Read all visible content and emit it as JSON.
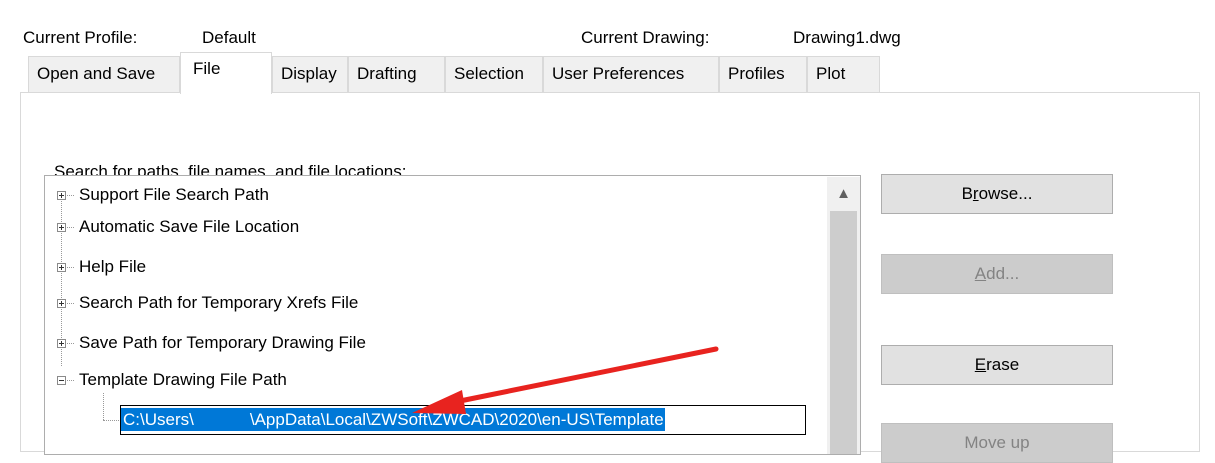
{
  "header": {
    "current_profile_label": "Current Profile:",
    "current_profile_value": "Default",
    "current_drawing_label": "Current Drawing:",
    "current_drawing_value": "Drawing1.dwg"
  },
  "tabs": [
    {
      "label": "Open and Save"
    },
    {
      "label": "File",
      "active": true
    },
    {
      "label": "Display"
    },
    {
      "label": "Drafting"
    },
    {
      "label": "Selection"
    },
    {
      "label": "User Preferences"
    },
    {
      "label": "Profiles"
    },
    {
      "label": "Plot"
    }
  ],
  "panel": {
    "search_label": "Search for paths, file names, and file locations:",
    "tree": [
      {
        "label": "Support File Search Path",
        "expanded": false
      },
      {
        "label": "Automatic Save File Location",
        "expanded": false
      },
      {
        "label": "Help File",
        "expanded": false
      },
      {
        "label": "Search Path for Temporary Xrefs File",
        "expanded": false
      },
      {
        "label": "Save Path for Temporary Drawing File",
        "expanded": false
      },
      {
        "label": "Template Drawing File Path",
        "expanded": true
      }
    ],
    "template_path": {
      "part1": "C:\\Users\\",
      "part2": "\\AppData\\Local\\ZWSoft\\ZWCAD\\2020\\en-US\\Template"
    }
  },
  "buttons": {
    "browse": {
      "before": "B",
      "underline": "r",
      "after": "owse...",
      "enabled": true
    },
    "add": {
      "before": "",
      "underline": "A",
      "after": "dd...",
      "enabled": false
    },
    "erase": {
      "before": "",
      "underline": "E",
      "after": "rase",
      "enabled": true
    },
    "move_up": {
      "label": "Move up",
      "enabled": false
    }
  },
  "colors": {
    "selection": "#0078d7",
    "annotation_arrow": "#e8231f"
  },
  "icons": {
    "scroll_up": "▲"
  }
}
